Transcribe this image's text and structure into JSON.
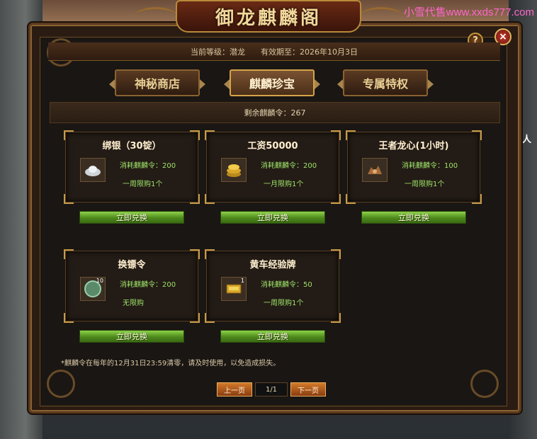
{
  "watermark": "小雪代售www.xxds777.com",
  "side_text": "商人",
  "window": {
    "title": "御龙麒麟阁",
    "header": {
      "level_label": "当前等级：潜龙",
      "valid_label": "有效期至：2026年10月3日"
    },
    "help_label": "?",
    "close_label": "×"
  },
  "tabs": [
    {
      "label": "神秘商店",
      "active": false
    },
    {
      "label": "麒麟珍宝",
      "active": true
    },
    {
      "label": "专属特权",
      "active": false
    }
  ],
  "remain": "剩余麒麟令：267",
  "items": [
    {
      "name": "绑银（30锭）",
      "cost": "消耗麒麟令：200",
      "limit": "一周限购1个",
      "icon": "silver-ingot-icon",
      "qty": "",
      "button": "立即兑换"
    },
    {
      "name": "工资50000",
      "cost": "消耗麒麟令：200",
      "limit": "一月限购1个",
      "icon": "gold-coins-icon",
      "qty": "",
      "button": "立即兑换"
    },
    {
      "name": "王者龙心(1小时)",
      "cost": "消耗麒麟令：100",
      "limit": "一周限购1个",
      "icon": "dragon-heart-icon",
      "qty": "",
      "button": "立即兑换"
    },
    {
      "name": "换镖令",
      "cost": "消耗麒麟令：200",
      "limit": "无限购",
      "icon": "escort-token-icon",
      "qty": "10",
      "button": "立即兑换"
    },
    {
      "name": "黄车经验牌",
      "cost": "消耗麒麟令：50",
      "limit": "一周限购1个",
      "icon": "yellow-cart-icon",
      "qty": "1",
      "button": "立即兑换"
    }
  ],
  "note": "*麒麟令在每年的12月31日23:59清零，请及时使用，以免造成损失。",
  "pager": {
    "prev": "上一页",
    "page": "1/1",
    "next": "下一页"
  },
  "colors": {
    "accent_green": "#9ee46a",
    "gold": "#c59a4a",
    "button_green": "#6aa82a"
  }
}
